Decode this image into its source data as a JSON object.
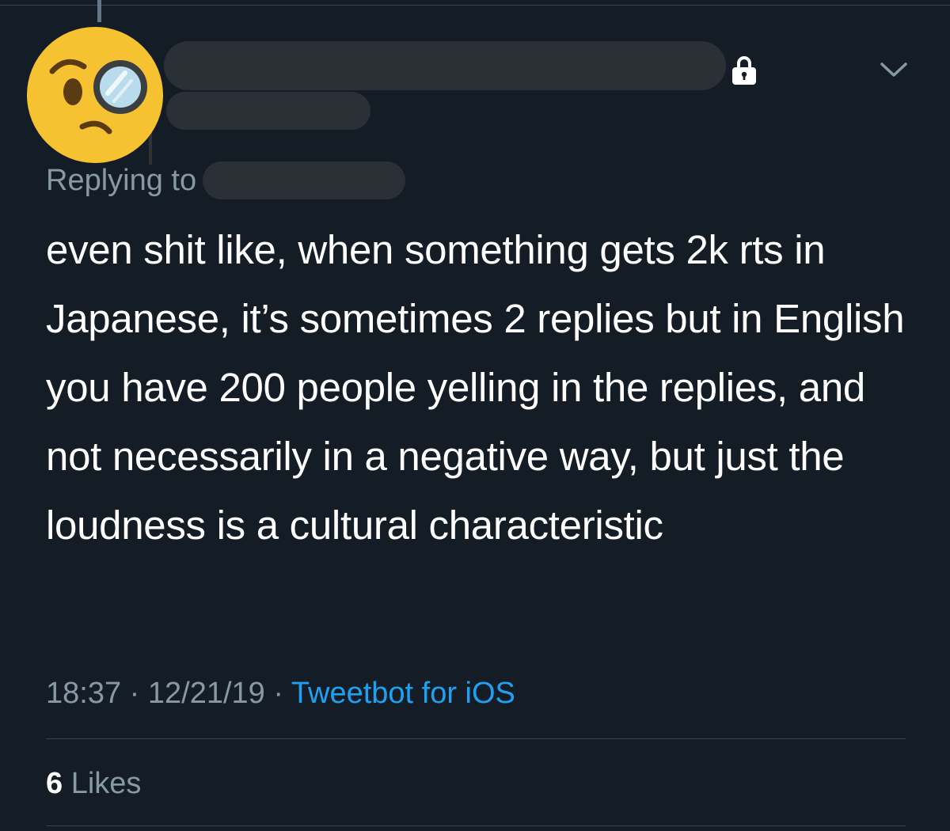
{
  "tweet": {
    "avatar_icon": "face-with-monocle-icon",
    "lock_icon": "lock-icon",
    "menu_icon": "chevron-down-icon",
    "replying_label": "Replying to",
    "text": "even shit like, when something gets 2k rts in Japanese, it’s sometimes 2 replies but in English you have 200 people yelling in the replies, and not necessarily in a negative way, but just the loudness is a cultural characteristic",
    "time": "18:37",
    "separator": "·",
    "date": "12/21/19",
    "client": "Tweetbot for iOS"
  },
  "stats": {
    "likes_count": "6",
    "likes_label": "Likes"
  },
  "colors": {
    "background": "#141d26",
    "text": "#ffffff",
    "muted": "#8899a6",
    "link": "#1da1f2",
    "redaction": "#2a3036",
    "divider": "#38444d",
    "emoji_face": "#f6c231"
  }
}
